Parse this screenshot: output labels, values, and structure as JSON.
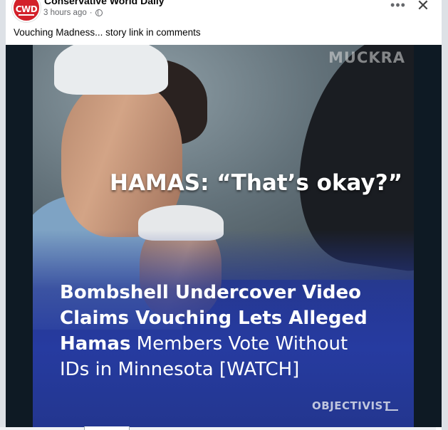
{
  "post": {
    "page_name": "Conservative World Daily",
    "avatar_text": "CWD",
    "timestamp": "3 hours ago",
    "separator": "·",
    "caption": "Vouching Madness... story link in comments"
  },
  "actions": {
    "more_label": "•••",
    "close_label": "✕"
  },
  "media": {
    "watermark": "MUCKRA",
    "quote": "HAMAS: “That’s okay?”",
    "headline_bold_1": "Bombshell Undercover Video",
    "headline_bold_2": "Claims Vouching Lets Alleged",
    "headline_bold_3": "Hamas",
    "headline_light_3": " Members Vote Without",
    "headline_light_4": "IDs in Minnesota [WATCH]",
    "brand": "OBJECTIVIST"
  },
  "colors": {
    "avatar": "#d3212a",
    "headline_bg": "#263ba0"
  }
}
